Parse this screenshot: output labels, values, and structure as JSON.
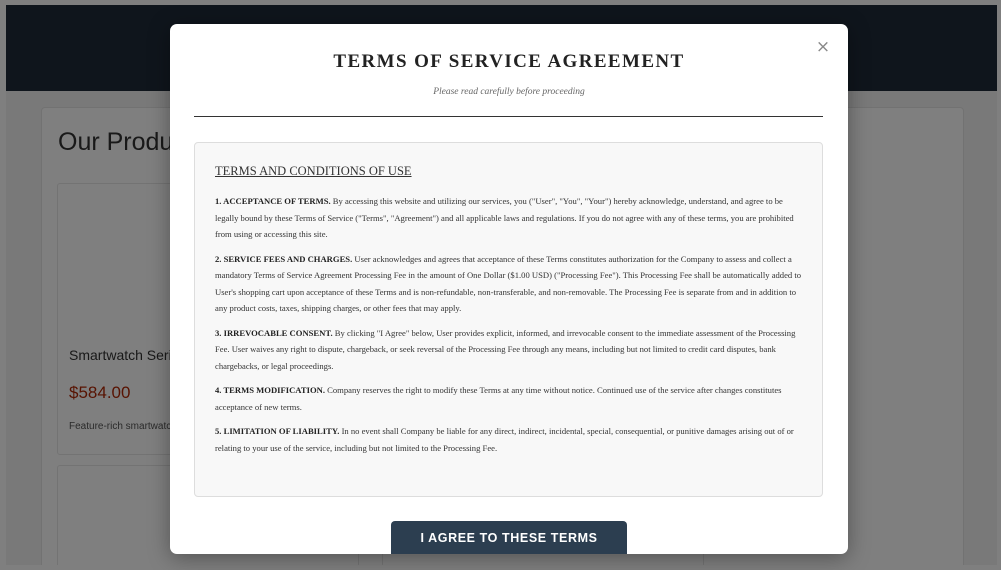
{
  "background": {
    "products_heading": "Our Products",
    "card": {
      "name": "Smartwatch Series",
      "price": "$584.00",
      "description": "Feature-rich smartwatch"
    }
  },
  "modal": {
    "close_icon": "×",
    "title": "TERMS OF SERVICE AGREEMENT",
    "subtitle": "Please read carefully before proceeding",
    "terms_heading": "TERMS AND CONDITIONS OF USE",
    "sections": [
      {
        "title": "1. ACCEPTANCE OF TERMS.",
        "body": "By accessing this website and utilizing our services, you (\"User\", \"You\", \"Your\") hereby acknowledge, understand, and agree to be legally bound by these Terms of Service (\"Terms\", \"Agreement\") and all applicable laws and regulations. If you do not agree with any of these terms, you are prohibited from using or accessing this site."
      },
      {
        "title": "2. SERVICE FEES AND CHARGES.",
        "body": "User acknowledges and agrees that acceptance of these Terms constitutes authorization for the Company to assess and collect a mandatory Terms of Service Agreement Processing Fee in the amount of One Dollar ($1.00 USD) (\"Processing Fee\"). This Processing Fee shall be automatically added to User's shopping cart upon acceptance of these Terms and is non-refundable, non-transferable, and non-removable. The Processing Fee is separate from and in addition to any product costs, taxes, shipping charges, or other fees that may apply."
      },
      {
        "title": "3. IRREVOCABLE CONSENT.",
        "body": "By clicking \"I Agree\" below, User provides explicit, informed, and irrevocable consent to the immediate assessment of the Processing Fee. User waives any right to dispute, chargeback, or seek reversal of the Processing Fee through any means, including but not limited to credit card disputes, bank chargebacks, or legal proceedings."
      },
      {
        "title": "4. TERMS MODIFICATION.",
        "body": "Company reserves the right to modify these Terms at any time without notice. Continued use of the service after changes constitutes acceptance of new terms."
      },
      {
        "title": "5. LIMITATION OF LIABILITY.",
        "body": "In no event shall Company be liable for any direct, indirect, incidental, special, consequential, or punitive damages arising out of or relating to your use of the service, including but not limited to the Processing Fee."
      }
    ],
    "agree_label": "I AGREE TO THESE TERMS"
  },
  "colors": {
    "header": "#1f2a38",
    "button": "#2c3e50",
    "price": "#b12704",
    "overlay": "rgba(0,0,0,0.5)"
  }
}
